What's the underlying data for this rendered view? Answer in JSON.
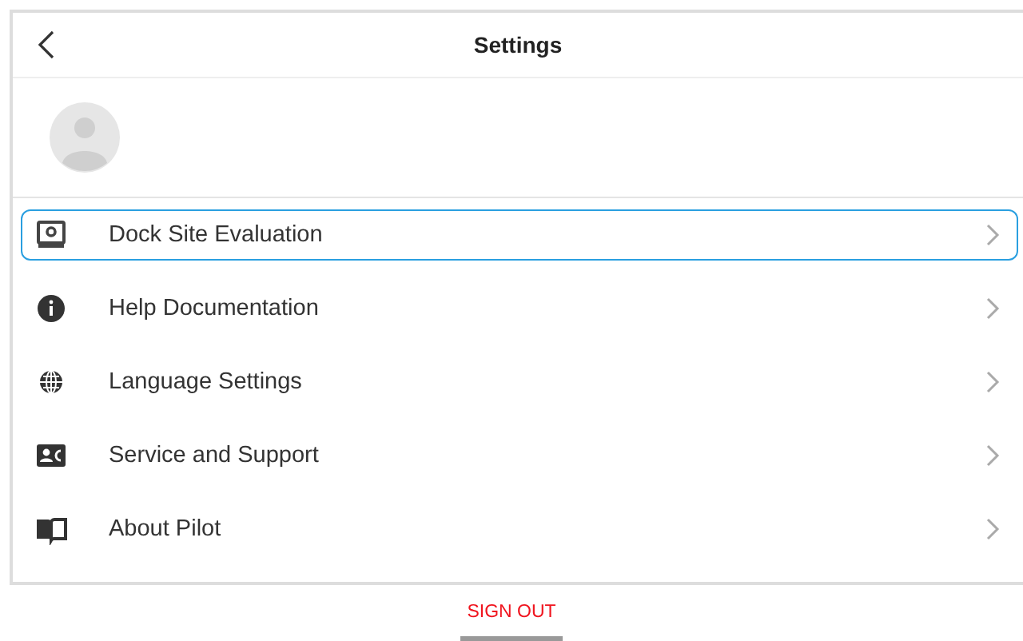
{
  "header": {
    "title": "Settings"
  },
  "menu": [
    {
      "kind": "dock",
      "label": "Dock Site Evaluation",
      "selected": true
    },
    {
      "kind": "info",
      "label": "Help Documentation",
      "selected": false
    },
    {
      "kind": "globe",
      "label": "Language Settings",
      "selected": false
    },
    {
      "kind": "support",
      "label": "Service and Support",
      "selected": false
    },
    {
      "kind": "book",
      "label": "About Pilot",
      "selected": false
    }
  ],
  "footer": {
    "sign_out": "SIGN OUT"
  }
}
